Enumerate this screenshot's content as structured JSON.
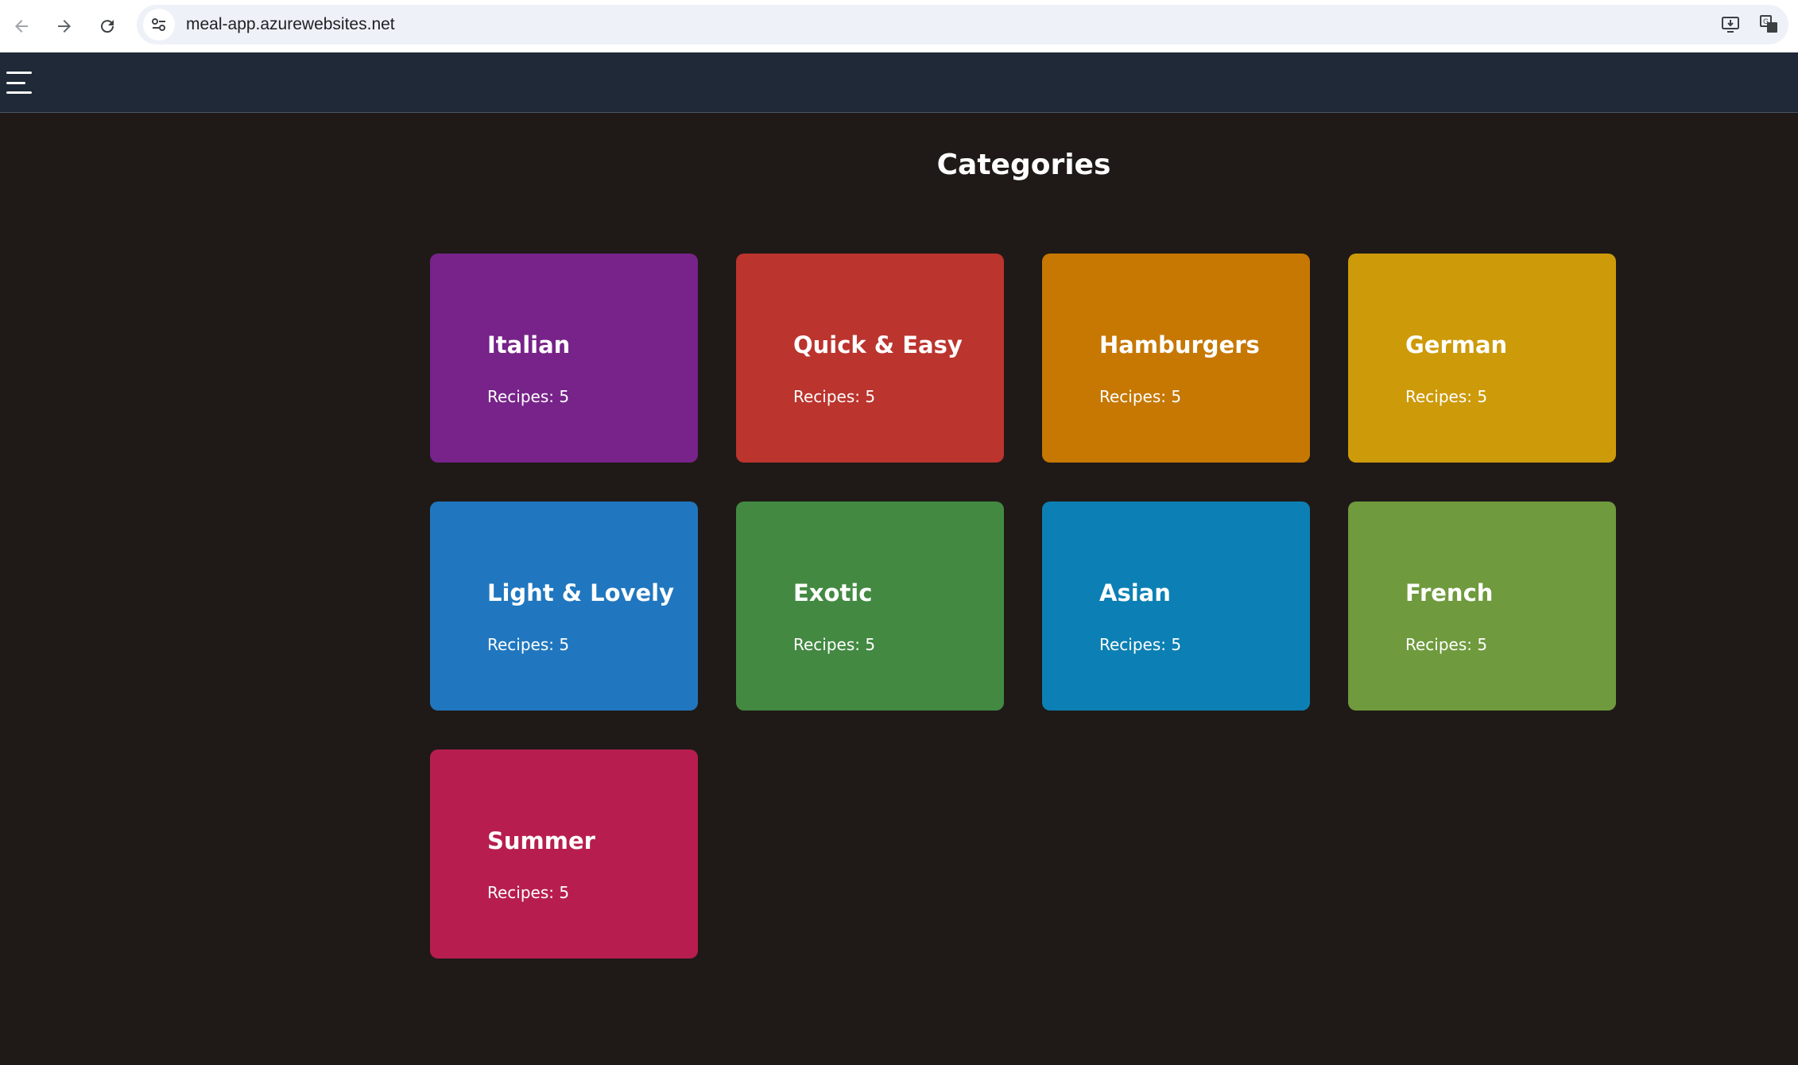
{
  "browser": {
    "url": "meal-app.azurewebsites.net",
    "back_icon": "arrow-left-icon",
    "forward_icon": "arrow-right-icon",
    "reload_icon": "reload-icon",
    "site_info_icon": "tune-icon",
    "install_icon": "install-app-icon",
    "translate_icon": "translate-icon"
  },
  "header": {
    "menu_icon": "hamburger-menu-icon",
    "background": "#1f2937"
  },
  "main": {
    "title": "Categories",
    "background": "#1f1a17",
    "categories": [
      {
        "name": "Italian",
        "count": "Recipes: 5",
        "color": "#77238a"
      },
      {
        "name": "Quick & Easy",
        "count": "Recipes: 5",
        "color": "#bb342e"
      },
      {
        "name": "Hamburgers",
        "count": "Recipes: 5",
        "color": "#c67803"
      },
      {
        "name": "German",
        "count": "Recipes: 5",
        "color": "#cd9a0a"
      },
      {
        "name": "Light & Lovely",
        "count": "Recipes: 5",
        "color": "#2077bf"
      },
      {
        "name": "Exotic",
        "count": "Recipes: 5",
        "color": "#438942"
      },
      {
        "name": "Asian",
        "count": "Recipes: 5",
        "color": "#0c80b4"
      },
      {
        "name": "French",
        "count": "Recipes: 5",
        "color": "#6f9a3d"
      },
      {
        "name": "Summer",
        "count": "Recipes: 5",
        "color": "#b71e4f"
      }
    ]
  }
}
